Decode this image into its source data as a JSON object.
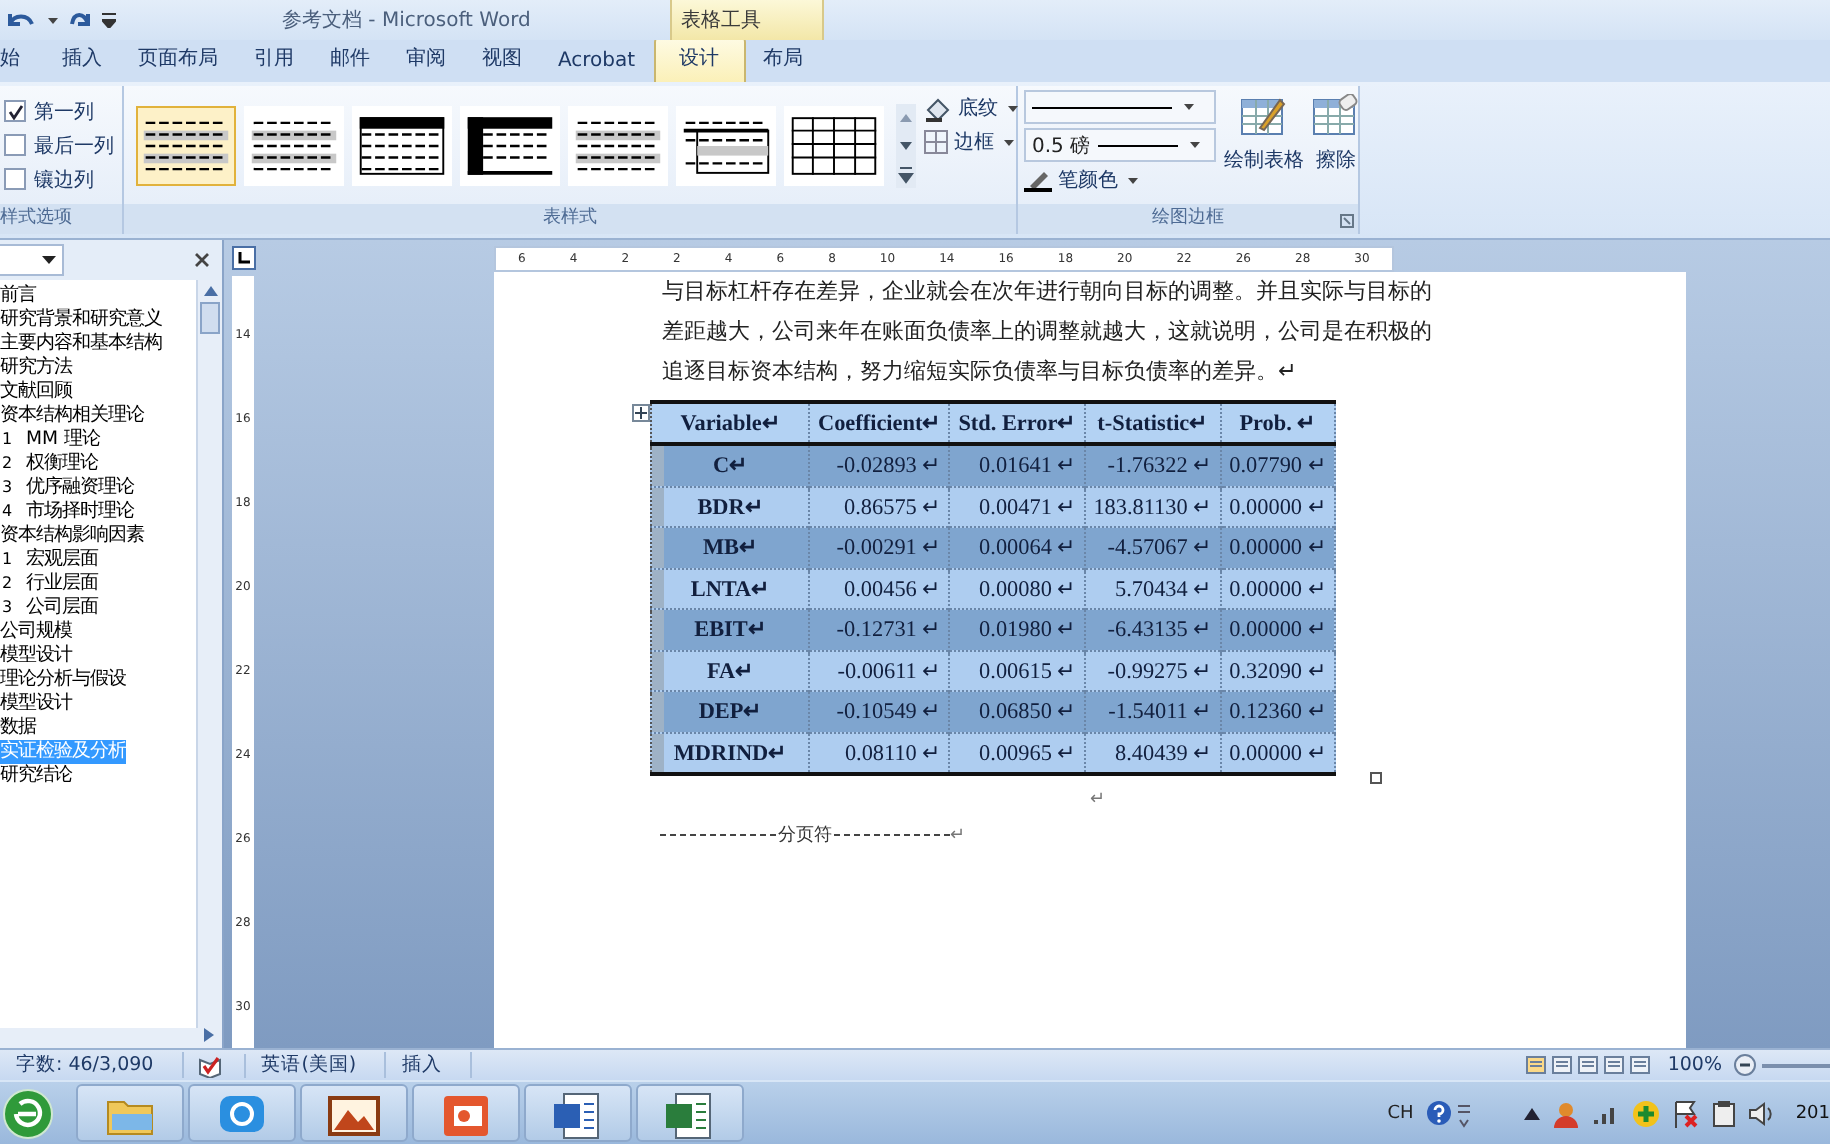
{
  "window": {
    "title": "参考文档 - Microsoft Word",
    "context_group": "表格工具"
  },
  "tabs": [
    {
      "label": "始",
      "selected": false
    },
    {
      "label": "插入",
      "selected": false
    },
    {
      "label": "页面布局",
      "selected": false
    },
    {
      "label": "引用",
      "selected": false
    },
    {
      "label": "邮件",
      "selected": false
    },
    {
      "label": "审阅",
      "selected": false
    },
    {
      "label": "视图",
      "selected": false
    },
    {
      "label": "Acrobat",
      "selected": false
    },
    {
      "label": "设计",
      "selected": true
    },
    {
      "label": "布局",
      "selected": false
    }
  ],
  "ribbon": {
    "style_options": {
      "title": "样式选项",
      "options": [
        {
          "label": "第一列",
          "checked": true
        },
        {
          "label": "最后一列",
          "checked": false
        },
        {
          "label": "镶边列",
          "checked": false
        }
      ]
    },
    "table_styles": {
      "title": "表样式",
      "styles": [
        {
          "kind": "banded",
          "selected": true
        },
        {
          "kind": "banded",
          "selected": false
        },
        {
          "kind": "header",
          "selected": false
        },
        {
          "kind": "firstcol",
          "selected": false
        },
        {
          "kind": "banded",
          "selected": false
        },
        {
          "kind": "topline",
          "selected": false
        },
        {
          "kind": "grid",
          "selected": false
        }
      ],
      "shading": "底纹",
      "borders": "边框"
    },
    "draw_borders": {
      "title": "绘图边框",
      "weight": "0.5 磅",
      "pen_color": "笔颜色",
      "draw_table": "绘制表格",
      "eraser": "擦除"
    }
  },
  "navigation": {
    "items": [
      {
        "label": "前言",
        "selected": false
      },
      {
        "label": "研究背景和研究意义",
        "selected": false
      },
      {
        "label": "主要内容和基本结构",
        "selected": false
      },
      {
        "label": "研究方法",
        "selected": false
      },
      {
        "label": "文献回顾",
        "selected": false
      },
      {
        "label": "资本结构相关理论",
        "selected": false,
        "children": [
          {
            "label": "1",
            "title": "MM 理论",
            "selected": false
          },
          {
            "label": "2",
            "title": "权衡理论",
            "selected": false
          },
          {
            "label": "3",
            "title": "优序融资理论",
            "selected": false
          },
          {
            "label": "4",
            "title": "市场择时理论",
            "selected": false
          }
        ]
      },
      {
        "label": "资本结构影响因素",
        "selected": false,
        "children": [
          {
            "label": "1",
            "title": "宏观层面",
            "selected": false
          },
          {
            "label": "2",
            "title": "行业层面",
            "selected": false
          },
          {
            "label": "3",
            "title": "公司层面",
            "selected": false
          }
        ]
      },
      {
        "label": " 公司规模",
        "selected": false
      },
      {
        "label": "模型设计",
        "selected": false
      },
      {
        "label": "理论分析与假设",
        "selected": false
      },
      {
        "label": "模型设计",
        "selected": false
      },
      {
        "label": "数据",
        "selected": false
      },
      {
        "label": "实证检验及分析",
        "selected": true
      },
      {
        "label": "研究结论",
        "selected": false
      }
    ]
  },
  "rulers": {
    "horizontal": [
      "6",
      "4",
      "2",
      "2",
      "4",
      "6",
      "8",
      "10",
      "14",
      "16",
      "18",
      "20",
      "22",
      "26",
      "28",
      "30"
    ],
    "vertical": [
      "14",
      "16",
      "18",
      "20",
      "22",
      "24",
      "26",
      "28",
      "30"
    ]
  },
  "document": {
    "paragraph": [
      "与目标杠杆存在差异，企业就会在次年进行朝向目标的调整。并且实际与目标的",
      "差距越大，公司来年在账面负债率上的调整就越大，这就说明，公司是在积极的",
      "追逐目标资本结构，努力缩短实际负债率与目标负债率的差异。↵"
    ],
    "table": {
      "columns": [
        "Variable↵",
        "Coefficient↵",
        "Std. Error↵",
        "t-Statistic↵",
        "Prob.  ↵"
      ],
      "rows": [
        [
          "C↵",
          "-0.02893 ↵",
          "0.01641 ↵",
          "-1.76322 ↵",
          "0.07790 ↵"
        ],
        [
          "BDR↵",
          "0.86575 ↵",
          "0.00471 ↵",
          "183.81130 ↵",
          "0.00000 ↵"
        ],
        [
          "MB↵",
          "-0.00291 ↵",
          "0.00064 ↵",
          "-4.57067 ↵",
          "0.00000 ↵"
        ],
        [
          "LNTA↵",
          "0.00456 ↵",
          "0.00080 ↵",
          "5.70434 ↵",
          "0.00000 ↵"
        ],
        [
          "EBIT↵",
          "-0.12731 ↵",
          "0.01980 ↵",
          "-6.43135 ↵",
          "0.00000 ↵"
        ],
        [
          "FA↵",
          "-0.00611 ↵",
          "0.00615 ↵",
          "-0.99275 ↵",
          "0.32090 ↵"
        ],
        [
          "DEP↵",
          "-0.10549 ↵",
          "0.06850 ↵",
          "-1.54011 ↵",
          "0.12360 ↵"
        ],
        [
          "MDRIND↵",
          "0.08110 ↵",
          "0.00965 ↵",
          "8.40439 ↵",
          "0.00000 ↵"
        ]
      ]
    },
    "after_table": "↵",
    "page_break": "分页符",
    "page_break_mark": "↵"
  },
  "status_bar": {
    "words": "字数: 46/3,090",
    "language": "英语(美国)",
    "mode": "插入",
    "zoom": "100%"
  },
  "taskbar": {
    "apps": [
      {
        "kind": "folder"
      },
      {
        "kind": "chat"
      },
      {
        "kind": "picture"
      },
      {
        "kind": "slides"
      },
      {
        "kind": "word"
      },
      {
        "kind": "excel"
      }
    ],
    "input": "CH",
    "clock": "201"
  }
}
